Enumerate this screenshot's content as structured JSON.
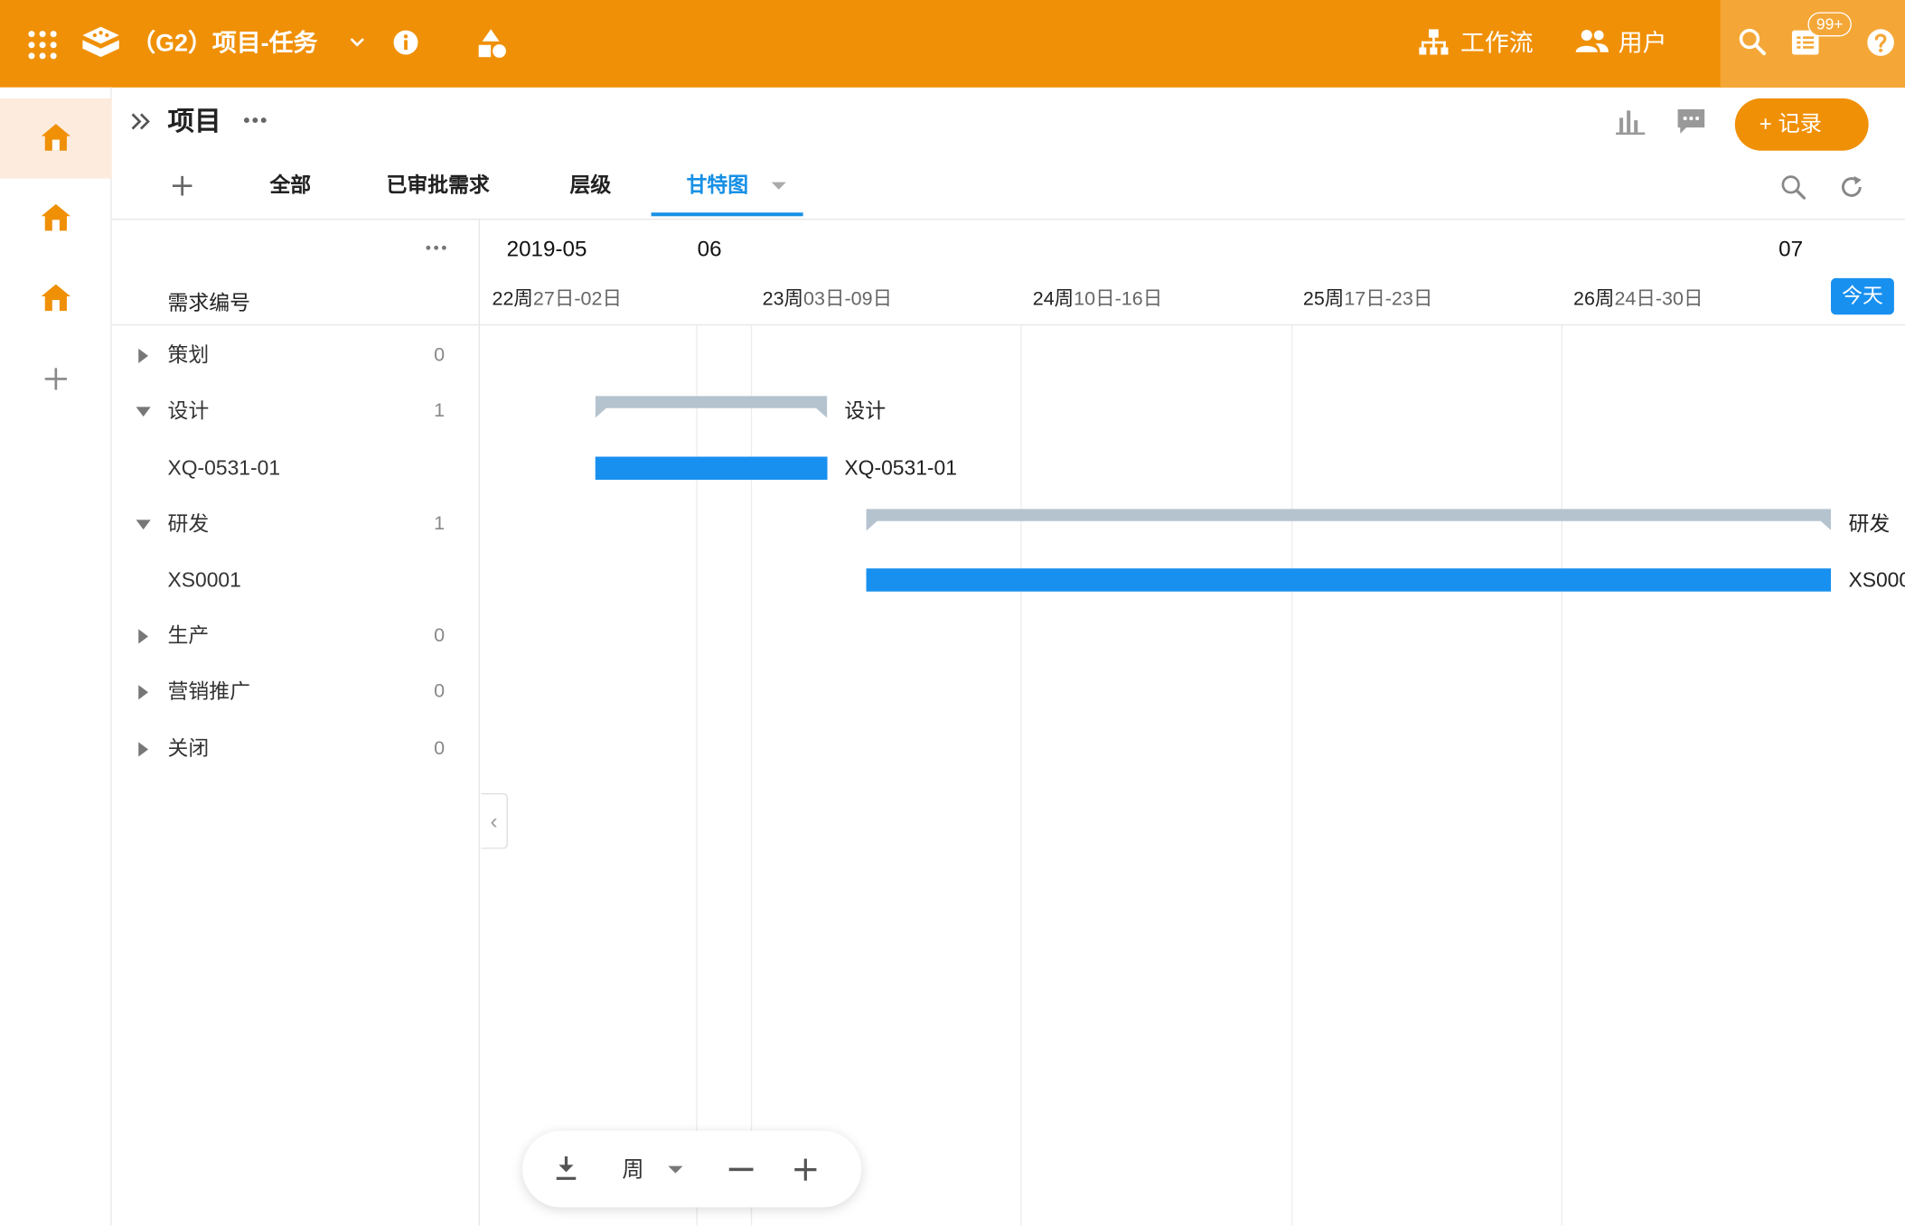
{
  "app": {
    "title": "（G2）项目-任务",
    "nav": {
      "workflow": "工作流",
      "users": "用户"
    },
    "notification_badge": "99+",
    "brand_color": "#F09007",
    "accent_color": "#1890F0"
  },
  "rail": {
    "icons": [
      "home-icon",
      "home-icon",
      "home-icon",
      "plus-icon"
    ]
  },
  "header": {
    "title": "项目",
    "record_button": "+ 记录"
  },
  "tabs": [
    {
      "label": "全部"
    },
    {
      "label": "已审批需求"
    },
    {
      "label": "层级"
    },
    {
      "label": "甘特图",
      "active": true
    }
  ],
  "gantt": {
    "list_header": "需求编号",
    "months": [
      "2019-05",
      "06",
      "07"
    ],
    "weeks": [
      {
        "num": "22周",
        "range": "27日-02日"
      },
      {
        "num": "23周",
        "range": "03日-09日"
      },
      {
        "num": "24周",
        "range": "10日-16日"
      },
      {
        "num": "25周",
        "range": "17日-23日"
      },
      {
        "num": "26周",
        "range": "24日-30日"
      }
    ],
    "today_label": "今天",
    "rows": [
      {
        "label": "策划",
        "count": "0",
        "type": "group",
        "expanded": false
      },
      {
        "label": "设计",
        "count": "1",
        "type": "group",
        "expanded": true,
        "bar": {
          "kind": "summary",
          "start": "2019-05-30",
          "end": "2019-06-05"
        }
      },
      {
        "label": "XQ-0531-01",
        "type": "task",
        "bar": {
          "kind": "task",
          "start": "2019-05-30",
          "end": "2019-06-05"
        }
      },
      {
        "label": "研发",
        "count": "1",
        "type": "group",
        "expanded": true,
        "bar": {
          "kind": "summary",
          "start": "2019-06-06",
          "end": "2019-07-01"
        }
      },
      {
        "label": "XS0001",
        "type": "task",
        "bar": {
          "kind": "task",
          "start": "2019-06-06",
          "end": "2019-07-01"
        }
      },
      {
        "label": "生产",
        "count": "0",
        "type": "group",
        "expanded": false
      },
      {
        "label": "营销推广",
        "count": "0",
        "type": "group",
        "expanded": false
      },
      {
        "label": "关闭",
        "count": "0",
        "type": "group",
        "expanded": false
      }
    ]
  },
  "toolbar": {
    "scale": "周"
  }
}
